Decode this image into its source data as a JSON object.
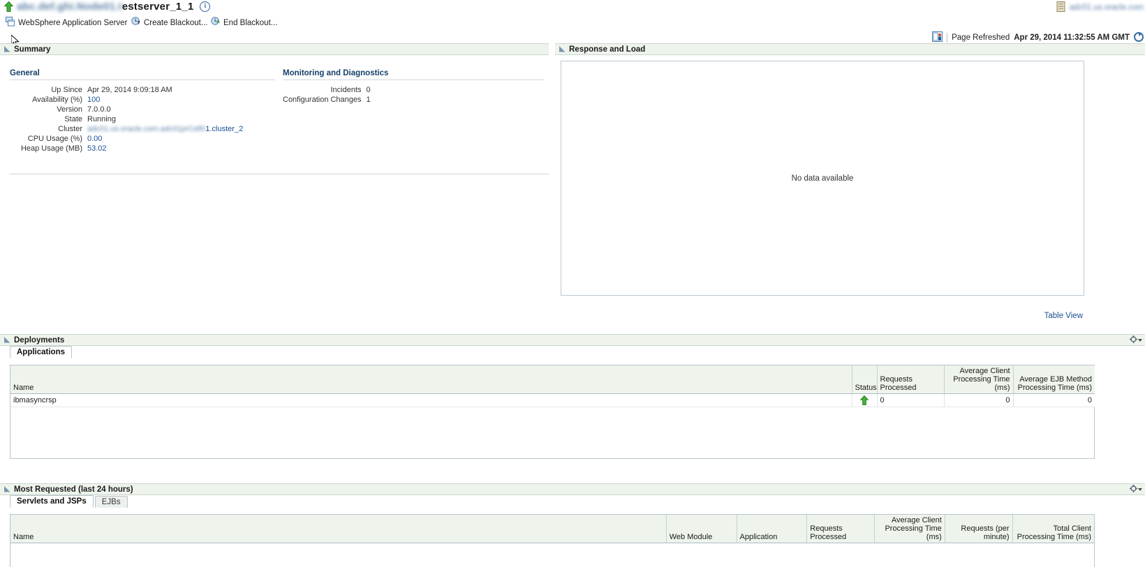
{
  "header": {
    "status_icon": "green-up-arrow-icon",
    "target_name_redacted": "abc.def.ghi.Node01.t",
    "target_name_visible": "estserver_1_1",
    "info_icon": "information-icon",
    "host_icon": "server-icon",
    "host_name_redacted": "adc01.us.oracle.com",
    "refresh_icon": "page-refresh-icon",
    "page_refreshed_label": "Page Refreshed",
    "page_refreshed_value": "Apr 29, 2014 11:32:55 AM GMT",
    "refresh_action_icon": "refresh-icon"
  },
  "toolbar": {
    "menu_icon": "websphere-server-icon",
    "menu_label": "WebSphere Application Server",
    "create_blackout_icon": "create-blackout-icon",
    "create_blackout_label": "Create Blackout...",
    "end_blackout_icon": "end-blackout-icon",
    "end_blackout_label": "End Blackout..."
  },
  "summary": {
    "title": "Summary",
    "general": {
      "title": "General",
      "rows": [
        {
          "label": "Up Since",
          "value": "Apr 29, 2014 9:09:18 AM",
          "link": false
        },
        {
          "label": "Availability (%)",
          "value": "100",
          "link": true
        },
        {
          "label": "Version",
          "value": "7.0.0.0",
          "link": false
        },
        {
          "label": "State",
          "value": "Running",
          "link": false
        },
        {
          "label": "Cluster",
          "value": "1.cluster_2",
          "link": true,
          "redacted_prefix": "adc01.us.oracle.com.adc01prCell0"
        },
        {
          "label": "CPU Usage (%)",
          "value": "0.00",
          "link": true
        },
        {
          "label": "Heap Usage (MB)",
          "value": "53.02",
          "link": true
        }
      ]
    },
    "monitoring": {
      "title": "Monitoring and Diagnostics",
      "rows": [
        {
          "label": "Incidents",
          "value": "0",
          "link": false
        },
        {
          "label": "Configuration Changes",
          "value": "1",
          "link": false
        }
      ]
    }
  },
  "response_and_load": {
    "title": "Response and Load",
    "empty_message": "No data available",
    "table_view_link": "Table View"
  },
  "deployments": {
    "title": "Deployments",
    "settings_icon": "gear-icon",
    "tabs": [
      {
        "label": "Applications",
        "active": true
      }
    ],
    "columns": [
      "Name",
      "Status",
      "Requests Processed",
      "Average Client Processing Time (ms)",
      "Average EJB Method Processing Time (ms)"
    ],
    "rows": [
      {
        "name": "ibmasyncrsp",
        "status_icon": "green-up-arrow-icon",
        "requests_processed": "0",
        "avg_client_processing_time": "0",
        "avg_ejb_method_processing_time": "0"
      }
    ]
  },
  "most_requested": {
    "title": "Most Requested (last 24 hours)",
    "settings_icon": "gear-icon",
    "tabs": [
      {
        "label": "Servlets and JSPs",
        "active": true
      },
      {
        "label": "EJBs",
        "active": false
      }
    ],
    "columns": [
      "Name",
      "Web Module",
      "Application",
      "Requests Processed",
      "Average Client Processing Time (ms)",
      "Requests (per minute)",
      "Total Client Processing Time (ms)"
    ],
    "rows": []
  },
  "colors": {
    "panel_header_bg": "#eef4ec",
    "link": "#1a4f91",
    "heading": "#16406b",
    "status_green": "#3faa35"
  }
}
